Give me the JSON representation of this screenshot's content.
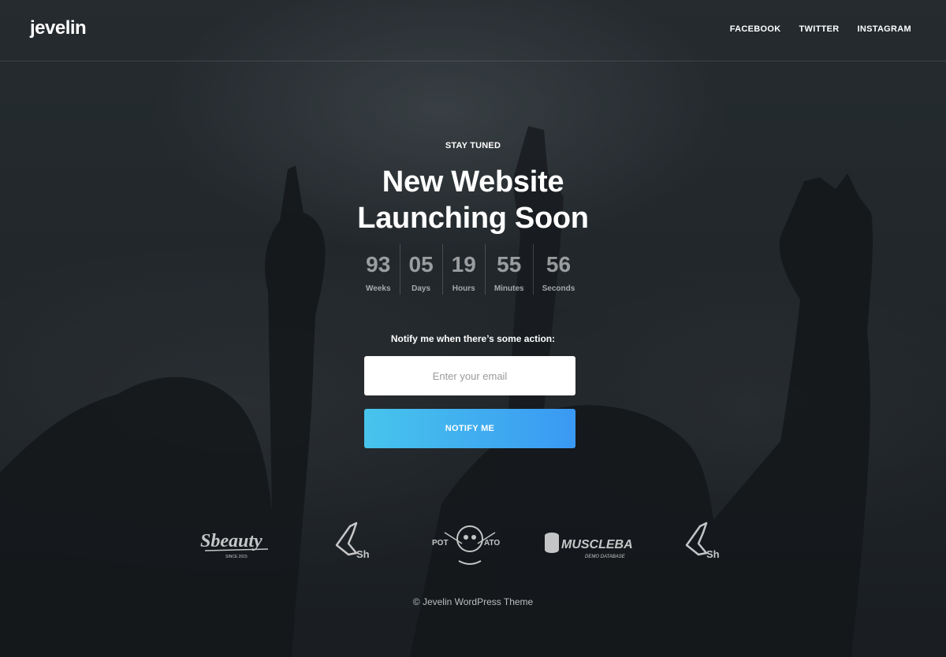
{
  "header": {
    "logo": "jevelin",
    "nav": [
      "FACEBOOK",
      "TWITTER",
      "INSTAGRAM"
    ]
  },
  "hero": {
    "eyebrow": "STAY TUNED",
    "title_line1": "New Website",
    "title_line2": "Launching Soon"
  },
  "countdown": [
    {
      "value": "93",
      "label": "Weeks"
    },
    {
      "value": "05",
      "label": "Days"
    },
    {
      "value": "19",
      "label": "Hours"
    },
    {
      "value": "55",
      "label": "Minutes"
    },
    {
      "value": "56",
      "label": "Seconds"
    }
  ],
  "subscribe": {
    "label": "Notify me when there’s some action:",
    "placeholder": "Enter your email",
    "button": "NOTIFY ME"
  },
  "brands": {
    "sbeauty": "Sbeauty",
    "sbeauty_sub": "SINCE 2015",
    "sh": "Sh",
    "potato_left": "POT",
    "potato_right": "ATO",
    "musclebase": "MUSCLEBASE",
    "musclebase_sub": "DEMO DATABASE"
  },
  "footer": "© Jevelin WordPress Theme",
  "colors": {
    "button_start": "#47c4ec",
    "button_end": "#3a99f3",
    "background": "#1d2226"
  }
}
